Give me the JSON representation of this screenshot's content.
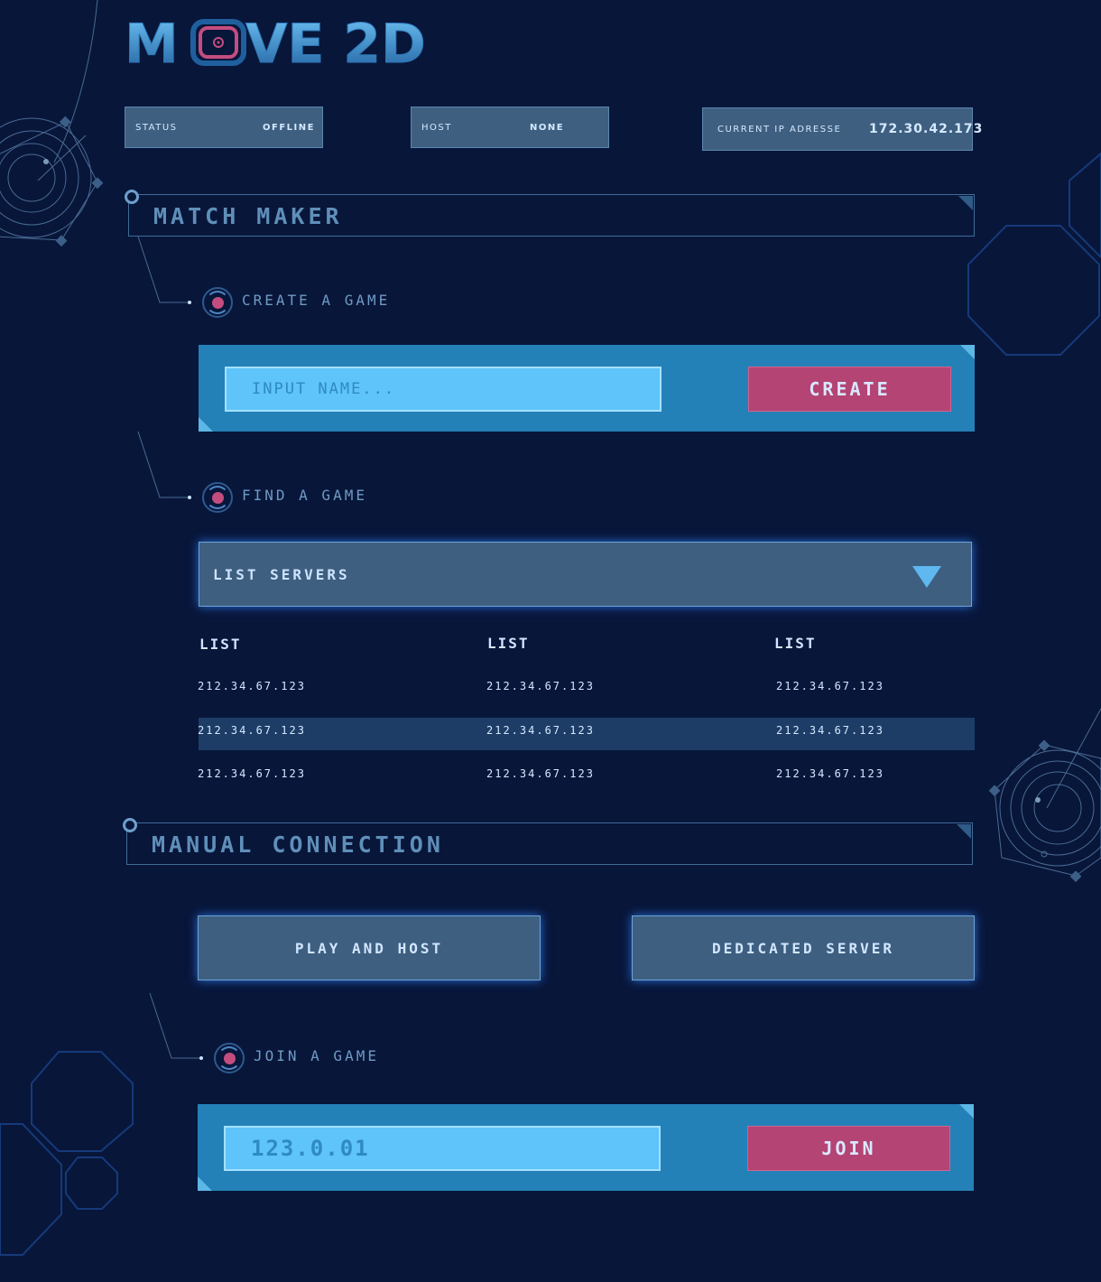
{
  "logo": {
    "text_before": "M",
    "text_after": "VE 2D"
  },
  "status_bar": {
    "status": {
      "label": "STATUS",
      "value": "OFFLINE"
    },
    "host": {
      "label": "HOST",
      "value": "NONE"
    },
    "ip": {
      "label": "CURRENT IP ADRESSE",
      "value": "172.30.42.173"
    }
  },
  "match_maker": {
    "title": "MATCH MAKER",
    "create": {
      "heading": "CREATE A GAME",
      "input_placeholder": "INPUT NAME...",
      "button": "CREATE"
    },
    "find": {
      "heading": "FIND A GAME",
      "dropdown_label": "LIST SERVERS",
      "columns": [
        "LIST",
        "LIST",
        "LIST"
      ],
      "rows": [
        [
          "212.34.67.123",
          "212.34.67.123",
          "212.34.67.123"
        ],
        [
          "212.34.67.123",
          "212.34.67.123",
          "212.34.67.123"
        ],
        [
          "212.34.67.123",
          "212.34.67.123",
          "212.34.67.123"
        ]
      ]
    }
  },
  "manual_connection": {
    "title": "MANUAL CONNECTION",
    "play_and_host": "PLAY AND HOST",
    "dedicated_server": "DEDICATED SERVER",
    "join": {
      "heading": "JOIN A GAME",
      "input_value": "123.0.01",
      "button": "JOIN"
    }
  },
  "colors": {
    "background": "#08163a",
    "panel": "#2481b8",
    "input": "#5ec4fa",
    "accent_button": "#b44473",
    "box": "#3e5f80"
  }
}
